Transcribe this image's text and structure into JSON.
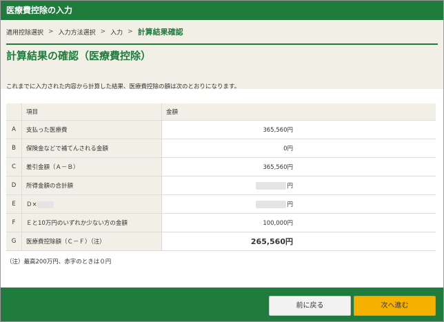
{
  "app": {
    "title": "医療費控除の入力"
  },
  "breadcrumb": {
    "steps": [
      "適用控除選択",
      "入力方法選択",
      "入力"
    ],
    "current": "計算結果確認",
    "separator": ">"
  },
  "page": {
    "title": "計算結果の確認（医療費控除）",
    "description": "これまでに入力された内容から計算した結果、医療費控除の額は次のとおりになります。"
  },
  "table": {
    "headers": {
      "key": "",
      "item": "項目",
      "amount": "金額"
    },
    "rows": [
      {
        "key": "A",
        "item": "支払った医療費",
        "amount": "365,560円"
      },
      {
        "key": "B",
        "item": "保険金などで補てんされる金額",
        "amount": "0円"
      },
      {
        "key": "C",
        "item": "差引金額（Ａ－Ｂ）",
        "amount": "365,560円"
      },
      {
        "key": "D",
        "item": "所得金額の合計額",
        "amount": "円"
      },
      {
        "key": "E",
        "item": "Ｄ×",
        "amount": "円"
      },
      {
        "key": "F",
        "item": "Ｅと10万円のいずれか少ない方の金額",
        "amount": "100,000円"
      },
      {
        "key": "G",
        "item": "医療費控除額（Ｃ－Ｆ）（注）",
        "amount": "265,560円"
      }
    ]
  },
  "note": "（注）最高200万円、赤字のときは０円",
  "buttons": {
    "back": "前に戻る",
    "next": "次へ進む"
  },
  "colors": {
    "brand": "#1f7c3d",
    "next_button": "#f5b000",
    "panel_bg": "#f2f0e6"
  }
}
